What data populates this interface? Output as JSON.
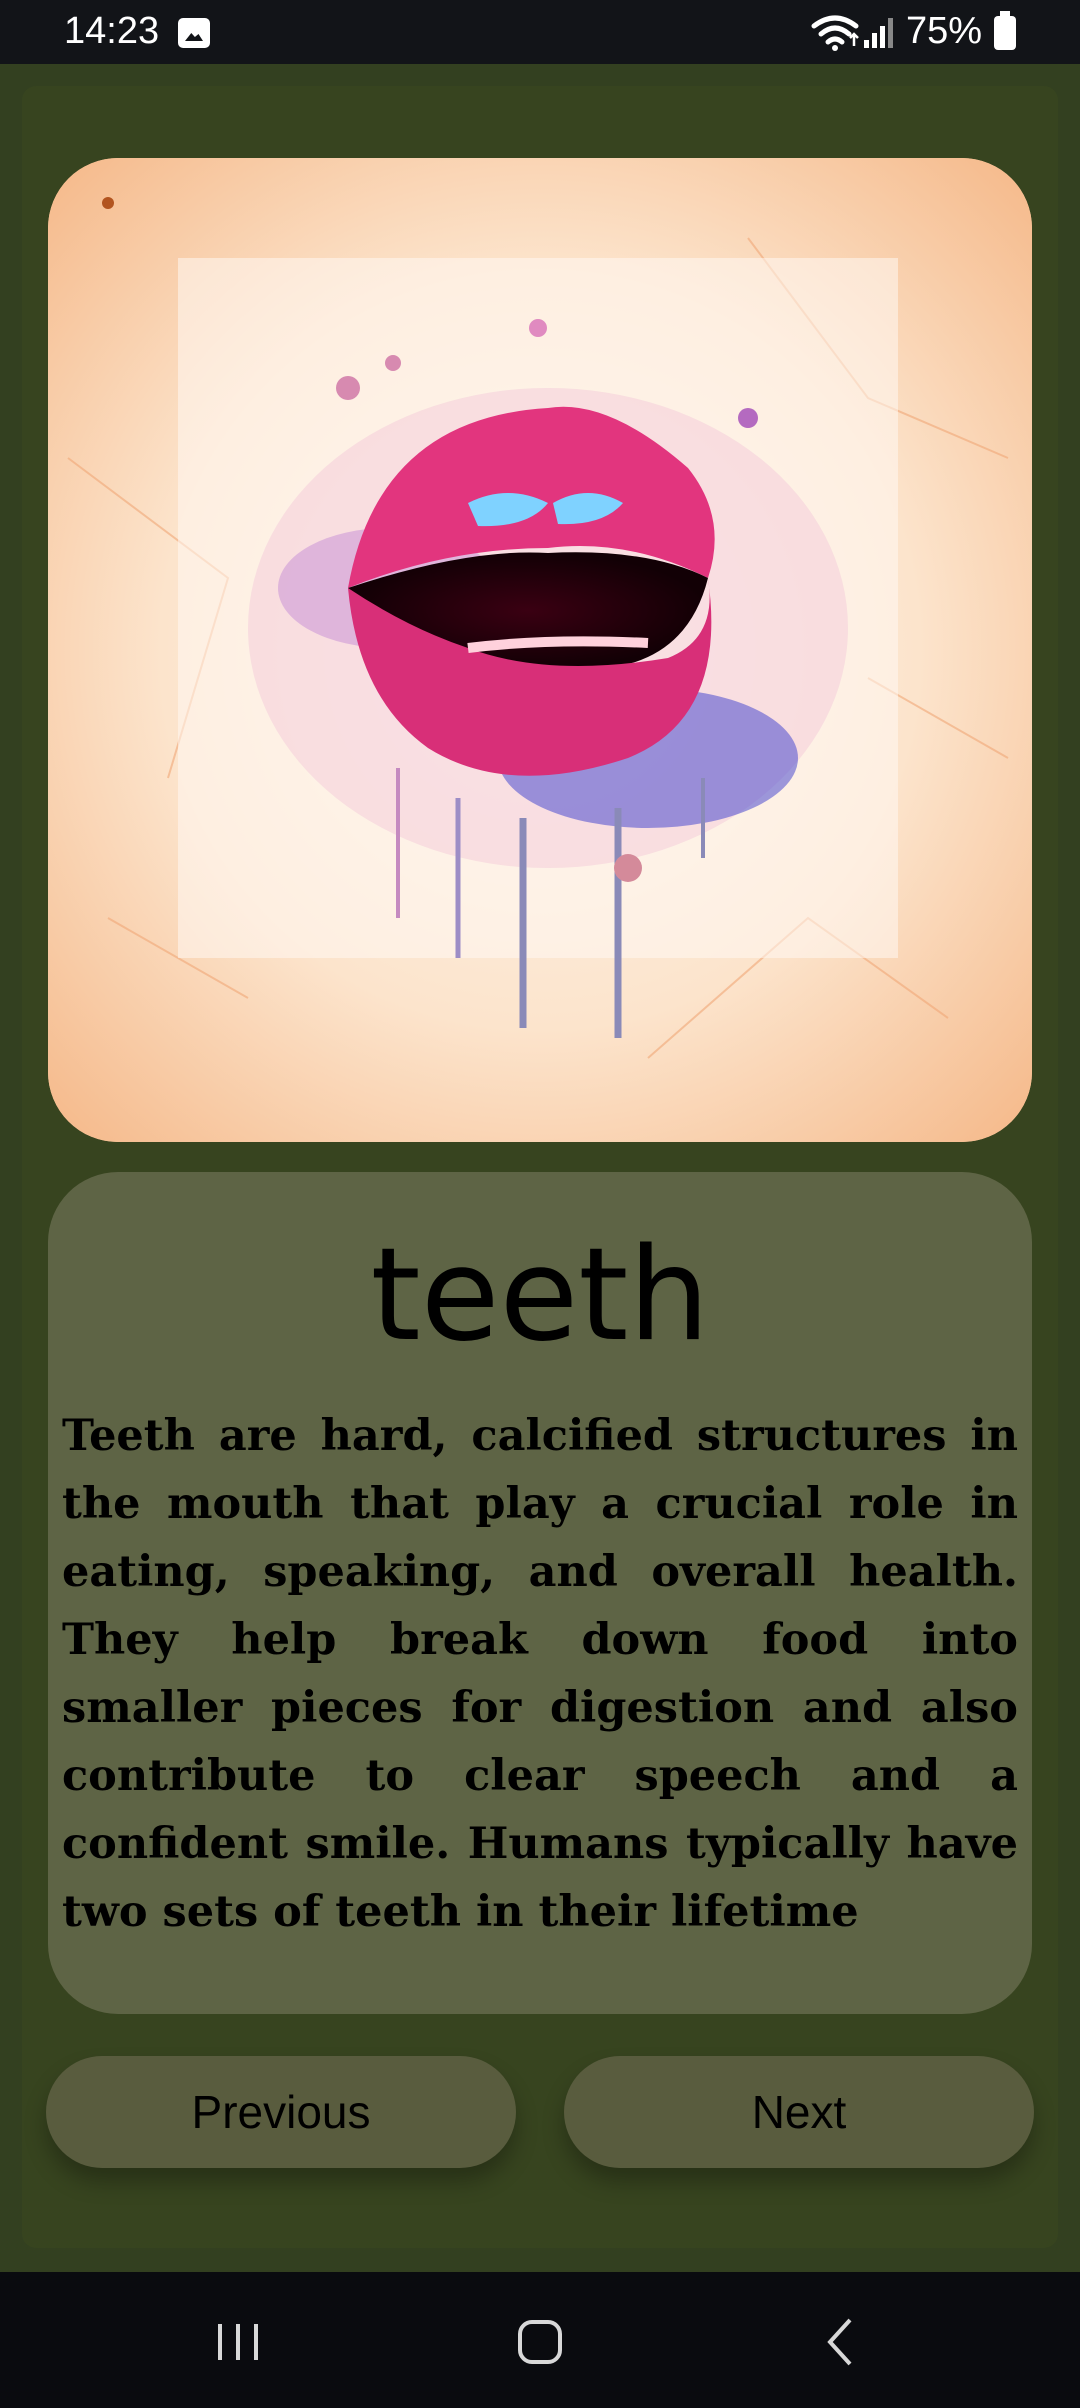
{
  "status_bar": {
    "time": "14:23",
    "battery": "75%",
    "icons": [
      "image-icon",
      "wifi-icon",
      "signal-icon",
      "battery-icon"
    ]
  },
  "card": {
    "image_alt": "watercolor lips illustration",
    "title": "teeth",
    "description": "Teeth are hard, calcified structures in the mouth that play a crucial role in eating, speaking, and overall health. They help break down food into smaller pieces for digestion and also contribute to clear speech and a confident smile. Humans typically have two sets of teeth in their lifetime"
  },
  "buttons": {
    "previous": "Previous",
    "next": "Next"
  },
  "navigation": {
    "icons": [
      "recents-icon",
      "home-icon",
      "back-icon"
    ]
  },
  "colors": {
    "background": "#334020",
    "panel": "#5e6445",
    "button": "#595c3e",
    "status_bar": "#121418",
    "nav_bar": "#0a0b0f"
  }
}
